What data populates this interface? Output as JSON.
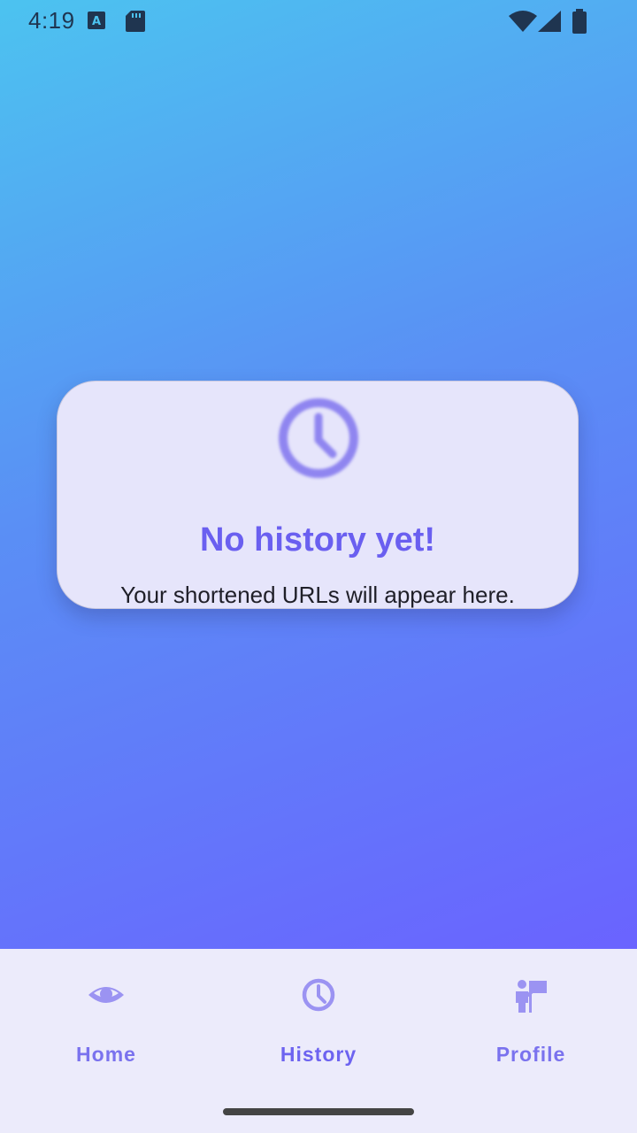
{
  "status_bar": {
    "time": "4:19",
    "icons": [
      "keyboard-a-icon",
      "sd-card-icon",
      "wifi-icon",
      "signal-icon",
      "battery-icon"
    ]
  },
  "empty_state": {
    "icon": "clock-icon",
    "title": "No history yet!",
    "subtitle": "Your shortened URLs will appear here."
  },
  "bottom_nav": {
    "items": [
      {
        "label": "Home",
        "icon": "eye-icon",
        "active": false
      },
      {
        "label": "History",
        "icon": "clock-icon",
        "active": true
      },
      {
        "label": "Profile",
        "icon": "person-flag-icon",
        "active": false
      }
    ]
  },
  "colors": {
    "gradient_start": "#4cc3f0",
    "gradient_end": "#6a63ff",
    "accent": "#6a5ff0",
    "card_bg": "#e6e5fb",
    "nav_bg": "#ecebfb"
  }
}
